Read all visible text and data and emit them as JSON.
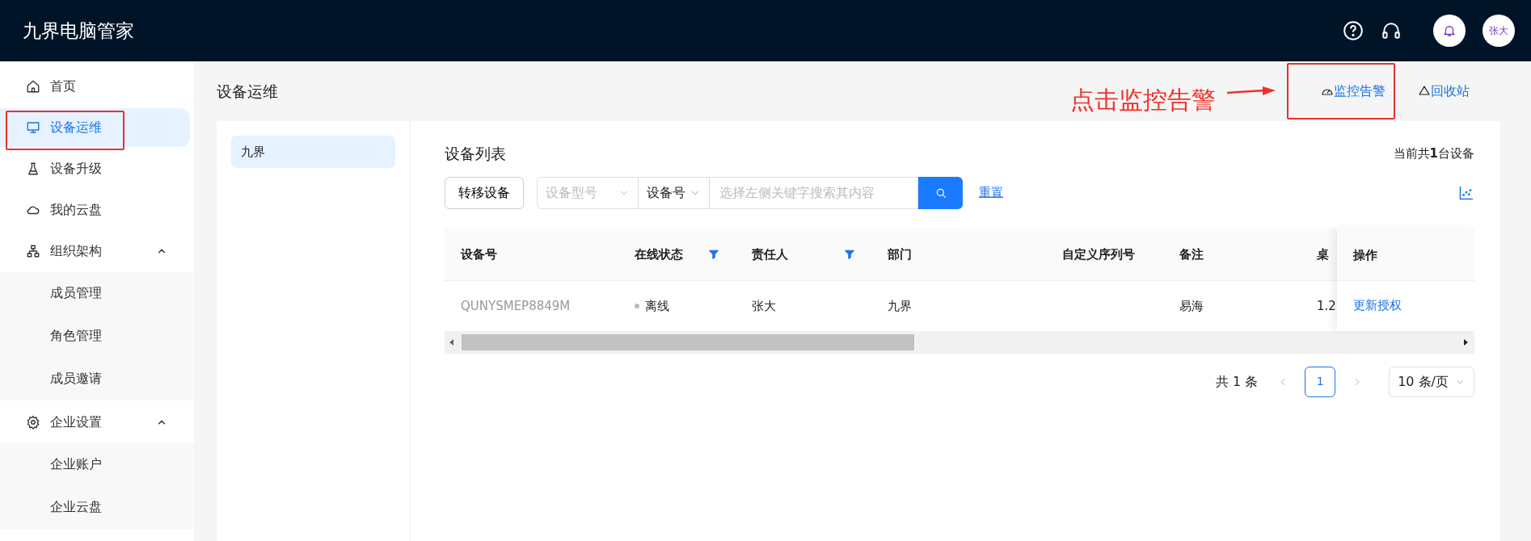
{
  "app": {
    "title": "九界电脑管家",
    "avatar": "张大"
  },
  "sidebar": {
    "items": [
      {
        "label": "首页",
        "selected": false
      },
      {
        "label": "设备运维",
        "selected": true
      },
      {
        "label": "设备升级",
        "selected": false
      },
      {
        "label": "我的云盘",
        "selected": false
      },
      {
        "label": "组织架构",
        "selected": false,
        "expanded": true,
        "children": [
          {
            "label": "成员管理",
            "selected": false
          },
          {
            "label": "角色管理",
            "selected": false
          },
          {
            "label": "成员邀请",
            "selected": false
          }
        ]
      },
      {
        "label": "企业设置",
        "selected": false,
        "expanded": true,
        "children": [
          {
            "label": "企业账户",
            "selected": false
          },
          {
            "label": "企业云盘",
            "selected": false
          }
        ]
      }
    ]
  },
  "page": {
    "title": "设备运维",
    "actions": [
      {
        "label": "监控告警"
      },
      {
        "label": "回收站"
      }
    ]
  },
  "annotation": {
    "text": "点击监控告警"
  },
  "tree": [
    {
      "label": "九界",
      "selected": true
    }
  ],
  "device_list": {
    "title": "设备列表",
    "summary": "当前共**1**台设备",
    "transfer_button": "转移设备",
    "model_select": {
      "placeholder": "设备型号"
    },
    "key_select": {
      "value": "设备号"
    },
    "search": {
      "placeholder": "选择左侧关键字搜索其内容"
    },
    "reset": "重置"
  },
  "table": {
    "columns": [
      {
        "label": "设备号",
        "filter": false
      },
      {
        "label": "在线状态",
        "filter": true
      },
      {
        "label": "责任人",
        "filter": true
      },
      {
        "label": "部门",
        "filter": false
      },
      {
        "label": "自定义序列号",
        "filter": false
      },
      {
        "label": "备注",
        "filter": false
      },
      {
        "label": "桌",
        "filter": false
      },
      {
        "label": "操作",
        "filter": false
      }
    ],
    "rows": [
      {
        "online": false,
        "cells": [
          "QUNYSMEP8849M",
          "离线",
          "张大",
          "九界",
          "",
          "易海",
          "1.2",
          "更新授权"
        ]
      }
    ]
  },
  "pagination": {
    "total": "共 1 条",
    "pages": [
      {
        "label": "1",
        "selected": true
      }
    ],
    "page_size": "10 条/页"
  }
}
